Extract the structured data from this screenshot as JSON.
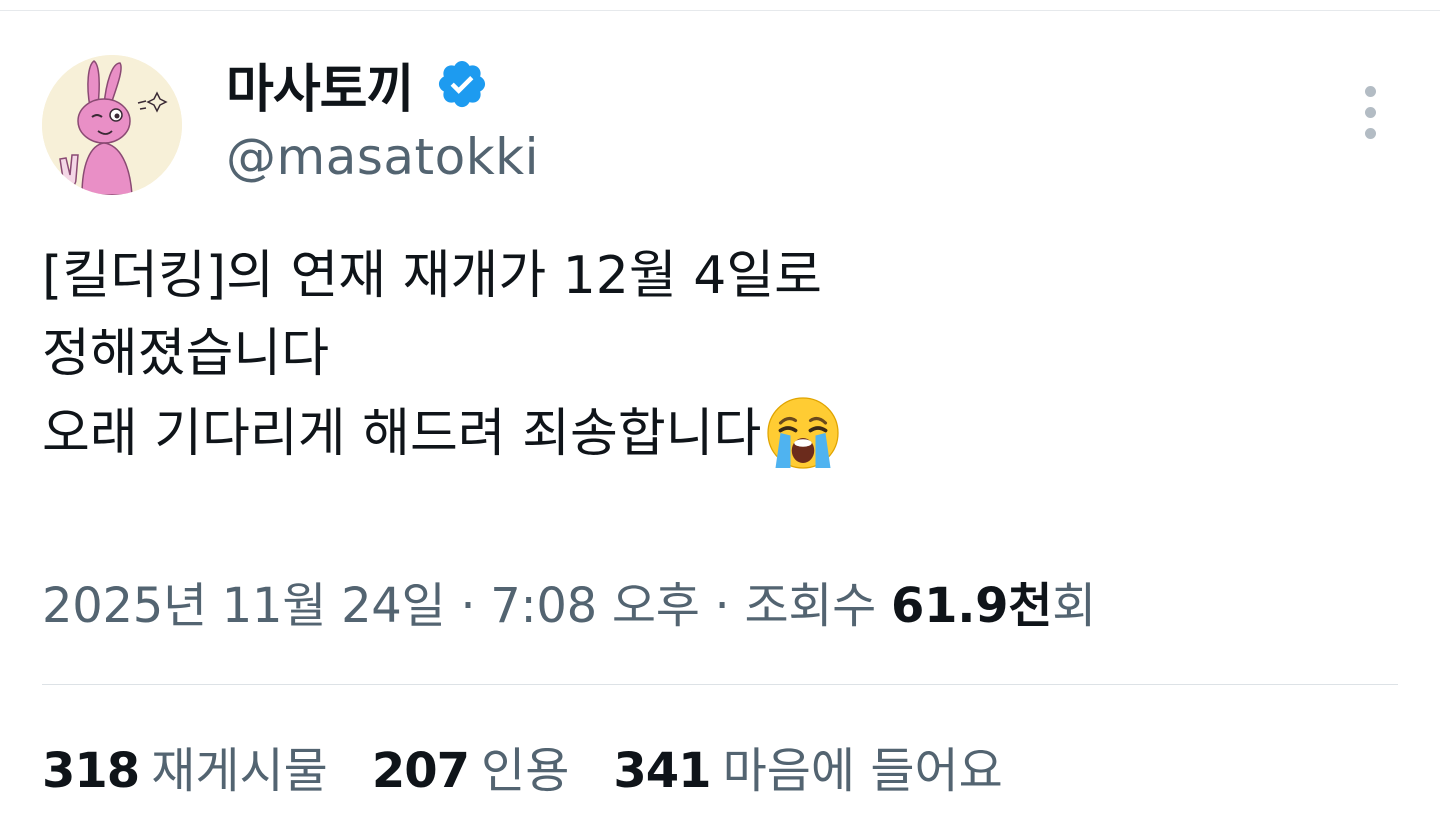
{
  "author": {
    "display_name": "마사토끼",
    "handle": "@masatokki",
    "verified": true,
    "verified_icon": "verified-badge-icon",
    "avatar_icon": "pink-rabbit-avatar"
  },
  "actions": {
    "more_icon": "more-vertical-icon"
  },
  "tweet": {
    "lines": [
      "[킬더킹]의 연재 재개가 12월 4일로",
      "정해졌습니다",
      "오래 기다리게 해드려 죄송합니다"
    ],
    "emoji": "loudly-crying-face-icon"
  },
  "meta": {
    "date": "2025년 11월 24일",
    "separator": " · ",
    "time": "7:08 오후",
    "views_prefix": "조회수 ",
    "views_count": "61.9천",
    "views_suffix": "회"
  },
  "stats": {
    "reposts": {
      "count": "318",
      "label": "재게시물"
    },
    "quotes": {
      "count": "207",
      "label": "인용"
    },
    "likes": {
      "count": "341",
      "label": "마음에 들어요"
    }
  },
  "colors": {
    "text_primary": "#0f1419",
    "text_secondary": "#536471",
    "verified_blue": "#1d9bf0",
    "divider": "#dde2e6"
  }
}
